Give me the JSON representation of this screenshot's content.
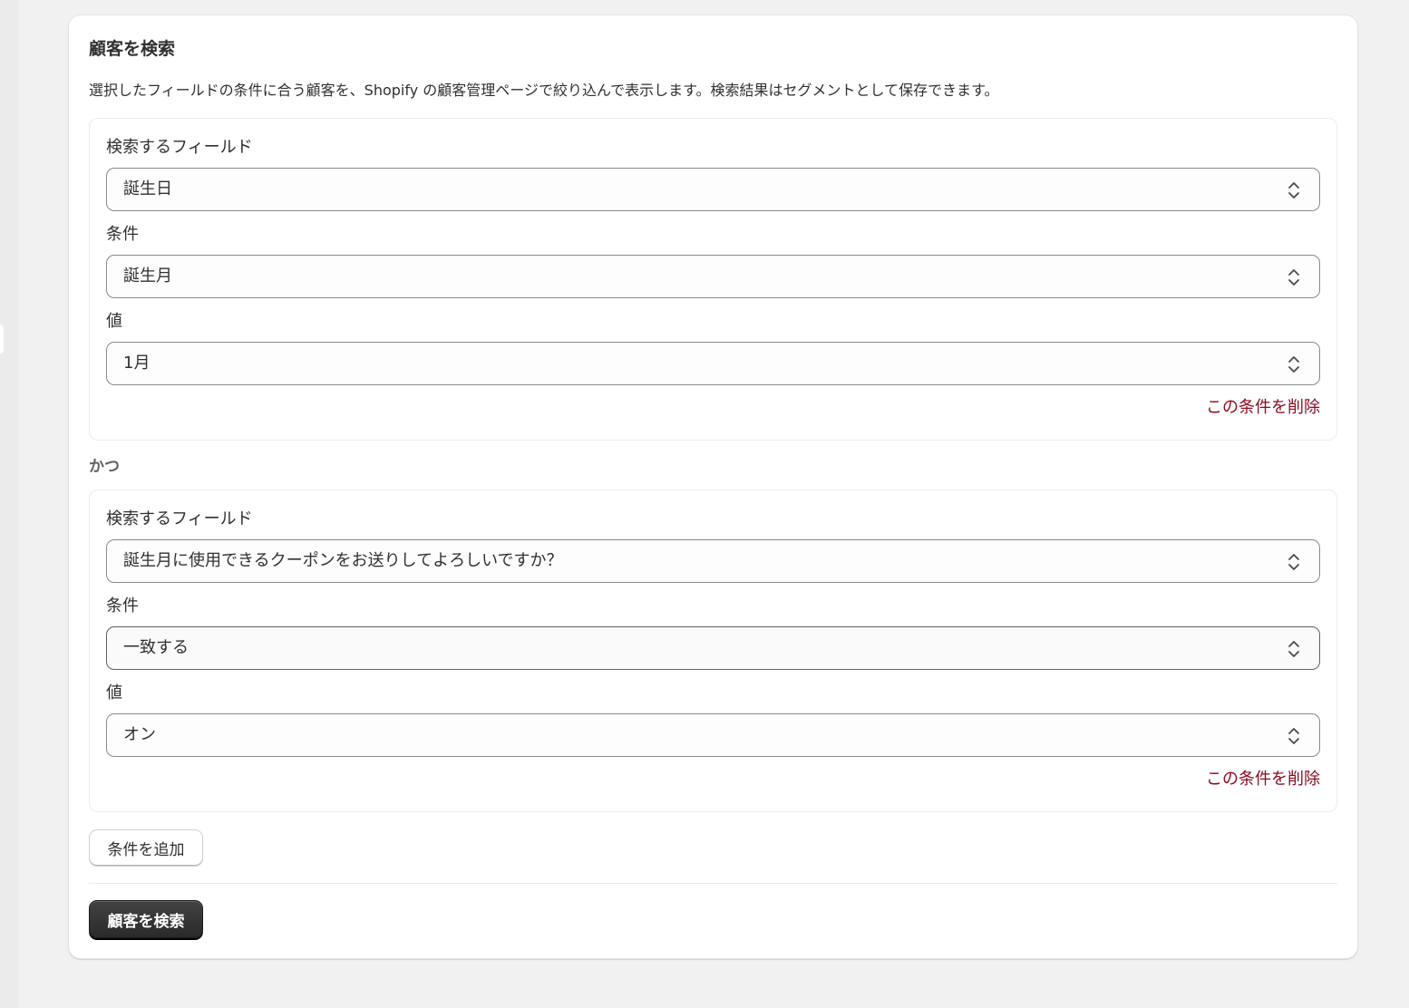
{
  "card": {
    "title": "顧客を検索",
    "description": "選択したフィールドの条件に合う顧客を、Shopify の顧客管理ページで絞り込んで表示します。検索結果はセグメントとして保存できます。"
  },
  "conditions": [
    {
      "field_label": "検索するフィールド",
      "field_value": "誕生日",
      "operator_label": "条件",
      "operator_value": "誕生月",
      "value_label": "値",
      "value_value": "1月",
      "delete_label": "この条件を削除"
    },
    {
      "field_label": "検索するフィールド",
      "field_value": "誕生月に使用できるクーポンをお送りしてよろしいですか？",
      "operator_label": "条件",
      "operator_value": "一致する",
      "value_label": "値",
      "value_value": "オン",
      "delete_label": "この条件を削除"
    }
  ],
  "connector_label": "かつ",
  "add_condition_label": "条件を追加",
  "search_button_label": "顧客を検索",
  "icons": {
    "select_chevron": "chevron-up-down-icon"
  },
  "colors": {
    "delete_link": "#8e0b21",
    "primary_button": "#303030"
  }
}
